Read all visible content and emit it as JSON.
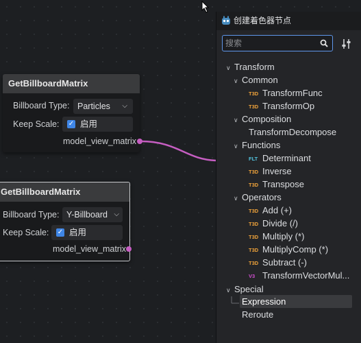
{
  "node1": {
    "title": "GetBillboardMatrix",
    "billboard_label": "Billboard Type:",
    "billboard_value": "Particles",
    "keep_scale_label": "Keep Scale:",
    "keep_scale_value": "启用",
    "output_label": "model_view_matrix"
  },
  "node2": {
    "title": "GetBillboardMatrix",
    "billboard_label": "Billboard Type:",
    "billboard_value": "Y-Billboard",
    "keep_scale_label": "Keep Scale:",
    "keep_scale_value": "启用",
    "output_label": "model_view_matrix"
  },
  "panel": {
    "title": "创建着色器节点",
    "search_placeholder": "搜索",
    "tree": {
      "transform": "Transform",
      "common": "Common",
      "transform_func": "TransformFunc",
      "transform_op": "TransformOp",
      "composition": "Composition",
      "transform_decompose": "TransformDecompose",
      "functions": "Functions",
      "determinant": "Determinant",
      "inverse": "Inverse",
      "transpose": "Transpose",
      "operators": "Operators",
      "add": "Add (+)",
      "divide": "Divide (/)",
      "multiply": "Multiply (*)",
      "multiply_comp": "MultiplyComp (*)",
      "subtract": "Subtract (-)",
      "transform_vector_mul": "TransformVectorMul...",
      "special": "Special",
      "expression": "Expression",
      "reroute": "Reroute"
    },
    "tags": {
      "t3d": "T3D",
      "flt": "FLT",
      "v3": "V3"
    },
    "colors": {
      "t3d": "#f0a33a",
      "flt": "#52c5e0",
      "v3": "#d14fd1",
      "accent": "#5f98ec"
    }
  }
}
